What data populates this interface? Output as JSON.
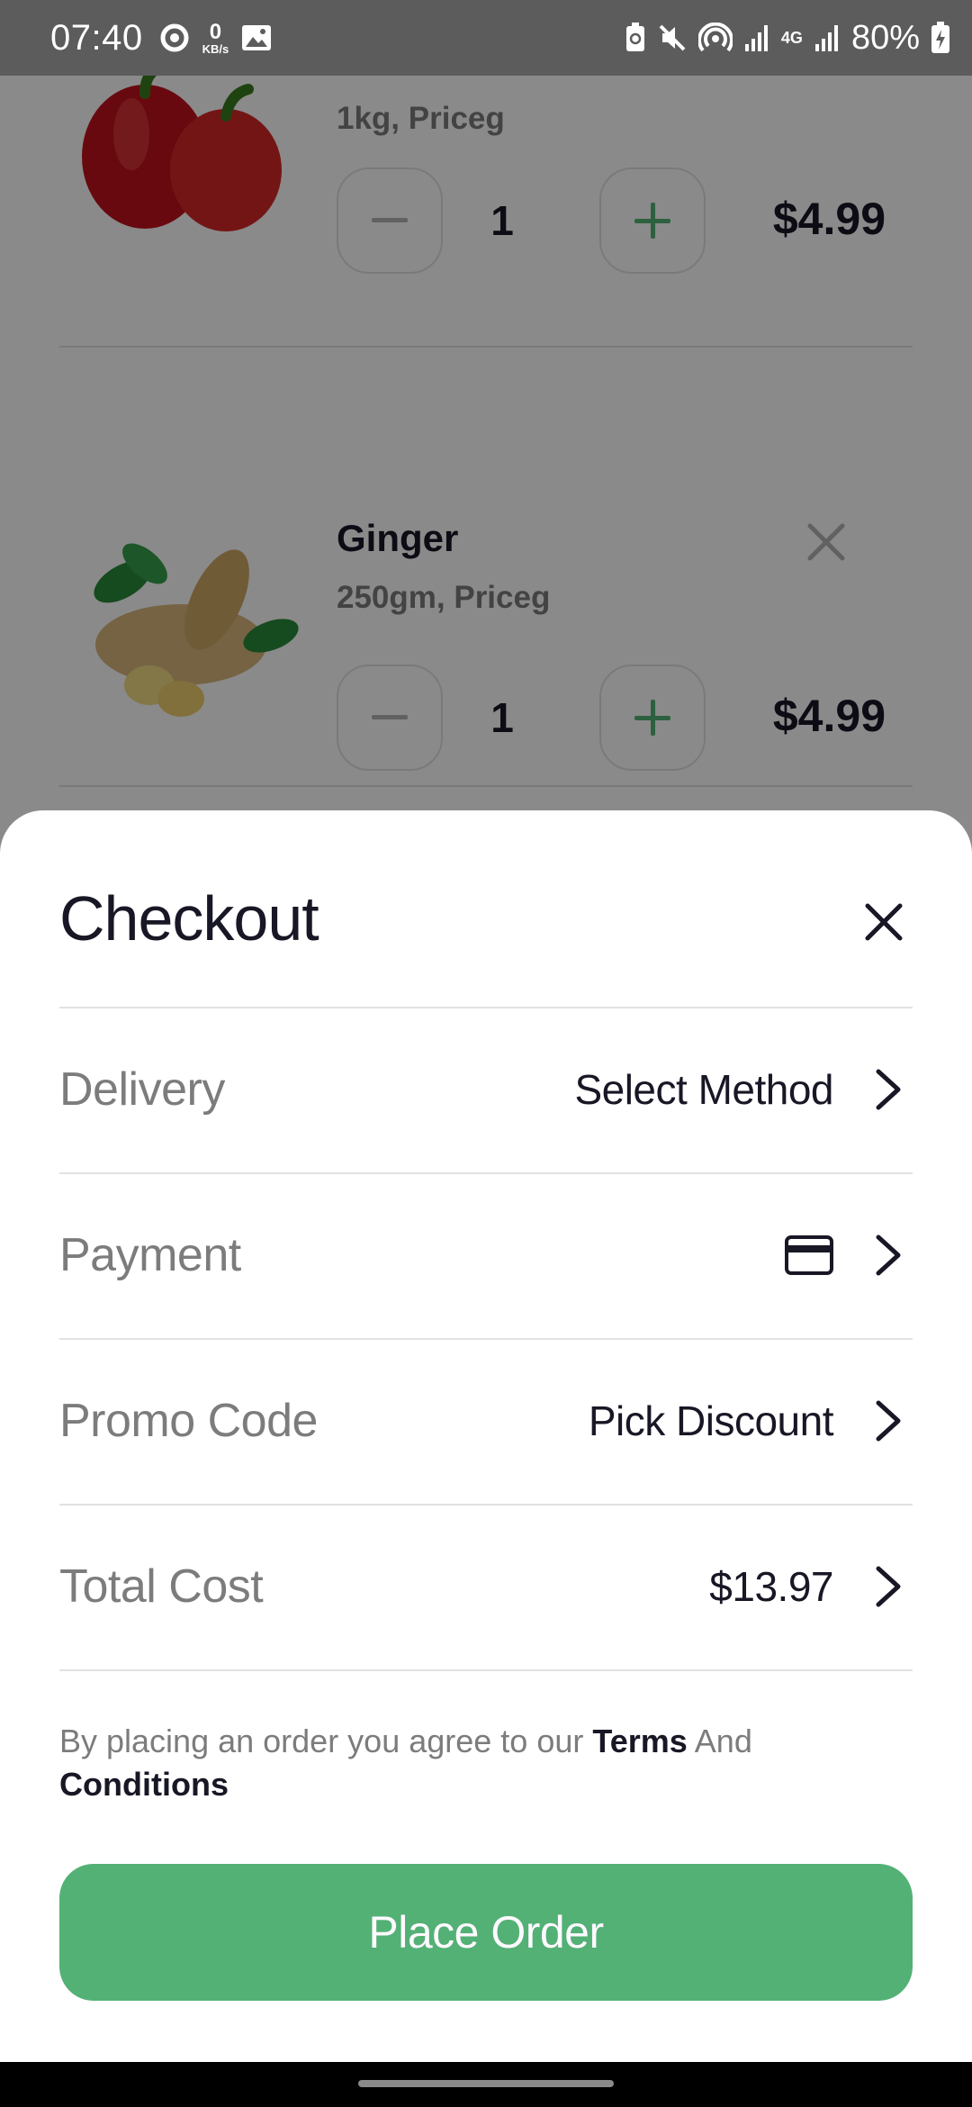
{
  "status_bar": {
    "time": "07:40",
    "kbs_value": "0",
    "kbs_unit": "KB/s",
    "network_label": "4G",
    "battery": "80%"
  },
  "cart": {
    "items": [
      {
        "name": "",
        "detail": "1kg, Priceg",
        "quantity": "1",
        "price": "$4.99",
        "image": "red-bell-pepper"
      },
      {
        "name": "Ginger",
        "detail": "250gm, Priceg",
        "quantity": "1",
        "price": "$4.99",
        "image": "ginger-with-mint"
      }
    ]
  },
  "checkout": {
    "title": "Checkout",
    "rows": [
      {
        "label": "Delivery",
        "value": "Select Method"
      },
      {
        "label": "Payment",
        "value_icon": "credit-card-icon"
      },
      {
        "label": "Promo Code",
        "value": "Pick Discount"
      },
      {
        "label": "Total Cost",
        "value": "$13.97"
      }
    ],
    "terms": {
      "prefix": "By placing an order you agree to our ",
      "terms": "Terms",
      "and": " And ",
      "conditions": "Conditions"
    },
    "place_order_label": "Place Order"
  },
  "colors": {
    "accent": "#53B175",
    "text_primary": "#181725",
    "text_secondary": "#7C7C7C",
    "divider": "#E2E2E2"
  }
}
